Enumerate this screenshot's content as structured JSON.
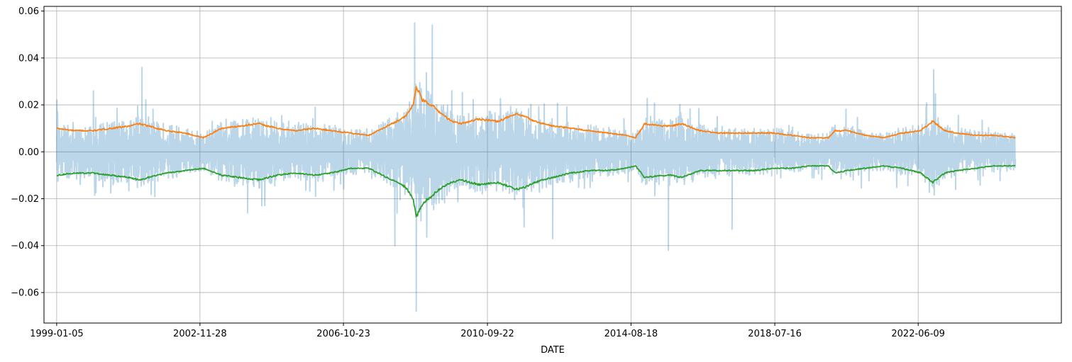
{
  "chart_data": {
    "type": "line",
    "title": "",
    "xlabel": "DATE",
    "ylabel": "",
    "ylim": [
      -0.073,
      0.062
    ],
    "x_tick_labels": [
      "1999-01-05",
      "2002-11-28",
      "2006-10-23",
      "2010-09-22",
      "2014-08-18",
      "2018-07-16",
      "2022-06-09"
    ],
    "x_range": [
      "1998-09-01",
      "2026-05-01"
    ],
    "x_data_range": [
      "1999-01-05",
      "2025-01-31"
    ],
    "y_ticks": [
      -0.06,
      -0.04,
      -0.02,
      0.0,
      0.02,
      0.04,
      0.06
    ],
    "y_tick_labels": [
      "−0.06",
      "−0.04",
      "−0.02",
      "0.00",
      "0.02",
      "0.04",
      "0.06"
    ],
    "grid": true,
    "legend": "none",
    "series": [
      {
        "color": "#1f77b4",
        "opacity": 0.3,
        "kind": "daily values (dense line)",
        "spikes": [
          {
            "x": "1999-01-07",
            "y": 0.022
          },
          {
            "x": "2000-01-05",
            "y": 0.026
          },
          {
            "x": "2001-05-01",
            "y": 0.036
          },
          {
            "x": "2004-03-15",
            "y": -0.026
          },
          {
            "x": "2004-08-03",
            "y": -0.023
          },
          {
            "x": "2008-03-17",
            "y": -0.04
          },
          {
            "x": "2008-09-29",
            "y": 0.055
          },
          {
            "x": "2008-10-15",
            "y": -0.068
          },
          {
            "x": "2009-03-23",
            "y": 0.054
          },
          {
            "x": "2011-09-22",
            "y": -0.032
          },
          {
            "x": "2012-07-01",
            "y": -0.037
          },
          {
            "x": "2015-08-24",
            "y": -0.042
          },
          {
            "x": "2017-05-18",
            "y": -0.033
          },
          {
            "x": "2022-11-10",
            "y": 0.035
          }
        ]
      },
      {
        "color": "#ff7f0e",
        "kind": "upper band",
        "x": [
          "1999-01-05",
          "1999-07-01",
          "2000-01-01",
          "2000-07-01",
          "2001-01-01",
          "2001-04-01",
          "2001-07-01",
          "2002-01-01",
          "2002-07-01",
          "2003-01-01",
          "2003-07-01",
          "2004-01-01",
          "2004-07-01",
          "2005-01-01",
          "2005-07-01",
          "2006-01-01",
          "2006-07-01",
          "2007-01-01",
          "2007-07-01",
          "2008-01-01",
          "2008-07-01",
          "2008-09-15",
          "2008-10-15",
          "2008-12-15",
          "2009-03-15",
          "2009-06-01",
          "2009-10-01",
          "2010-01-01",
          "2010-07-01",
          "2011-01-01",
          "2011-07-01",
          "2011-10-01",
          "2012-01-01",
          "2012-07-01",
          "2013-01-01",
          "2013-07-01",
          "2014-01-01",
          "2014-07-01",
          "2014-10-01",
          "2015-01-01",
          "2015-07-01",
          "2015-10-01",
          "2016-01-01",
          "2016-07-01",
          "2017-01-01",
          "2017-07-01",
          "2018-01-01",
          "2018-07-01",
          "2019-01-01",
          "2019-07-01",
          "2020-01-01",
          "2020-03-01",
          "2020-07-01",
          "2021-01-01",
          "2021-07-01",
          "2022-01-01",
          "2022-07-01",
          "2022-11-01",
          "2023-03-01",
          "2023-07-01",
          "2024-01-01",
          "2024-07-01",
          "2025-01-31"
        ],
        "y": [
          0.01,
          0.009,
          0.009,
          0.01,
          0.011,
          0.012,
          0.011,
          0.009,
          0.008,
          0.006,
          0.01,
          0.011,
          0.012,
          0.01,
          0.009,
          0.01,
          0.009,
          0.008,
          0.007,
          0.011,
          0.015,
          0.02,
          0.028,
          0.022,
          0.02,
          0.017,
          0.013,
          0.012,
          0.014,
          0.013,
          0.016,
          0.015,
          0.013,
          0.011,
          0.01,
          0.009,
          0.008,
          0.007,
          0.006,
          0.012,
          0.011,
          0.011,
          0.012,
          0.009,
          0.008,
          0.008,
          0.008,
          0.008,
          0.007,
          0.006,
          0.006,
          0.009,
          0.009,
          0.007,
          0.006,
          0.008,
          0.009,
          0.013,
          0.009,
          0.008,
          0.007,
          0.007,
          0.006
        ]
      },
      {
        "color": "#2ca02c",
        "kind": "lower band",
        "x": [
          "1999-01-05",
          "1999-07-01",
          "2000-01-01",
          "2000-07-01",
          "2001-01-01",
          "2001-04-01",
          "2001-07-01",
          "2002-01-01",
          "2002-07-01",
          "2003-01-01",
          "2003-07-01",
          "2004-01-01",
          "2004-07-01",
          "2005-01-01",
          "2005-07-01",
          "2006-01-01",
          "2006-07-01",
          "2007-01-01",
          "2007-07-01",
          "2008-01-01",
          "2008-07-01",
          "2008-09-15",
          "2008-10-15",
          "2008-12-15",
          "2009-03-15",
          "2009-06-01",
          "2009-10-01",
          "2010-01-01",
          "2010-07-01",
          "2011-01-01",
          "2011-07-01",
          "2011-10-01",
          "2012-01-01",
          "2012-07-01",
          "2013-01-01",
          "2013-07-01",
          "2014-01-01",
          "2014-07-01",
          "2014-10-01",
          "2015-01-01",
          "2015-07-01",
          "2015-10-01",
          "2016-01-01",
          "2016-07-01",
          "2017-01-01",
          "2017-07-01",
          "2018-01-01",
          "2018-07-01",
          "2019-01-01",
          "2019-07-01",
          "2020-01-01",
          "2020-03-01",
          "2020-07-01",
          "2021-01-01",
          "2021-07-01",
          "2022-01-01",
          "2022-07-01",
          "2022-11-01",
          "2023-03-01",
          "2023-07-01",
          "2024-01-01",
          "2024-07-01",
          "2025-01-31"
        ],
        "y": [
          -0.01,
          -0.009,
          -0.009,
          -0.01,
          -0.011,
          -0.012,
          -0.011,
          -0.009,
          -0.008,
          -0.007,
          -0.01,
          -0.011,
          -0.012,
          -0.01,
          -0.009,
          -0.01,
          -0.009,
          -0.007,
          -0.007,
          -0.011,
          -0.015,
          -0.02,
          -0.028,
          -0.022,
          -0.019,
          -0.016,
          -0.013,
          -0.012,
          -0.014,
          -0.013,
          -0.016,
          -0.015,
          -0.013,
          -0.011,
          -0.009,
          -0.008,
          -0.008,
          -0.007,
          -0.006,
          -0.011,
          -0.01,
          -0.01,
          -0.011,
          -0.008,
          -0.008,
          -0.008,
          -0.008,
          -0.007,
          -0.007,
          -0.006,
          -0.006,
          -0.009,
          -0.008,
          -0.007,
          -0.006,
          -0.007,
          -0.009,
          -0.013,
          -0.009,
          -0.008,
          -0.007,
          -0.006,
          -0.006
        ]
      }
    ]
  }
}
